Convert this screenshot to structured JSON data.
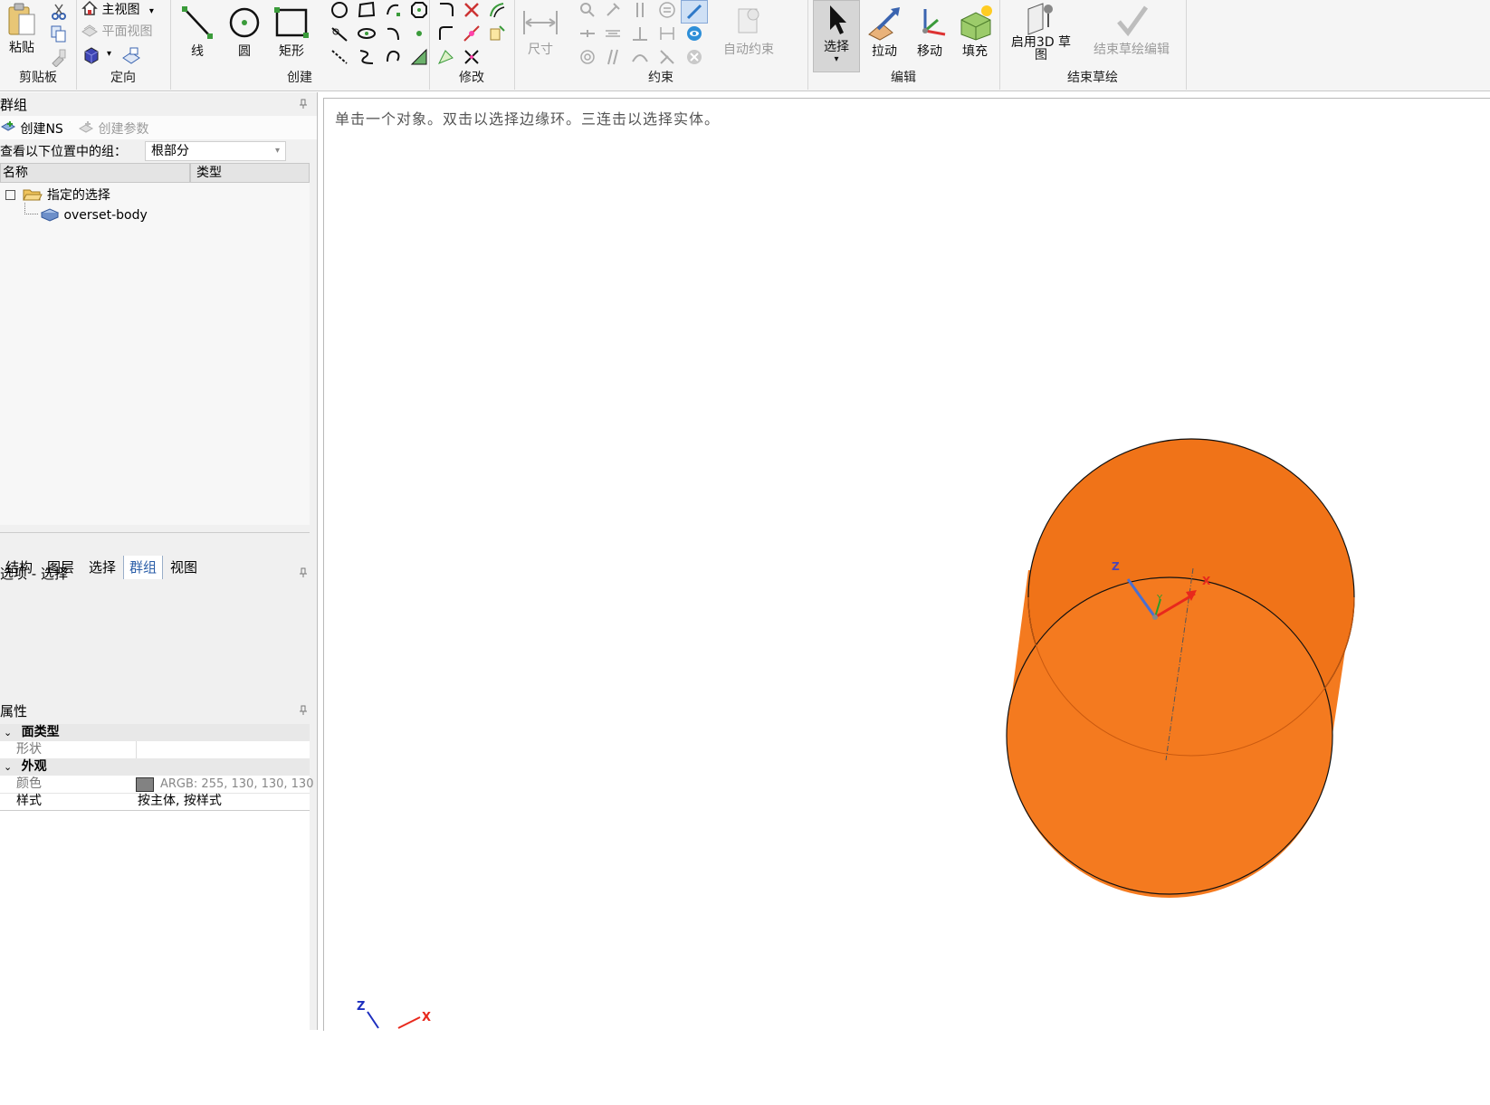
{
  "ribbon": {
    "clipboard": {
      "paste": "粘贴",
      "group": "剪贴板"
    },
    "orient": {
      "home_view": "主视图",
      "plan_view": "平面视图",
      "group": "定向"
    },
    "create": {
      "line": "线",
      "circle": "圆",
      "rect": "矩形",
      "group": "创建"
    },
    "modify": {
      "group": "修改"
    },
    "constraint": {
      "dimension": "尺寸",
      "auto": "自动约束",
      "group": "约束"
    },
    "edit": {
      "select": "选择",
      "pull": "拉动",
      "move": "移动",
      "fill": "填充",
      "group": "编辑"
    },
    "finish": {
      "enable3d": "启用3D 草图",
      "end_edit": "结束草绘编辑",
      "group": "结束草绘"
    }
  },
  "groups_panel": {
    "title": "群组",
    "create_ns": "创建NS",
    "create_param": "创建参数",
    "view_label": "查看以下位置中的组：",
    "view_value": "根部分",
    "col_name": "名称",
    "col_type": "类型",
    "tree": {
      "folder": "指定的选择",
      "child": "overset-body"
    }
  },
  "tabs": [
    "结构",
    "图层",
    "选择",
    "群组",
    "视图"
  ],
  "options_panel": {
    "title": "选项 - 选择"
  },
  "properties_panel": {
    "title": "属性",
    "face_type": "面类型",
    "shape": "形状",
    "appearance": "外观",
    "color_label": "颜色",
    "color_value": "ARGB: 255, 130, 130, 130",
    "style_label": "样式",
    "style_value": "按主体, 按样式"
  },
  "viewport": {
    "hint": "单击一个对象。双击以选择边缘环。三连击以选择实体。",
    "axis_z": "Z",
    "axis_x": "X",
    "axis_y": "Y",
    "body_color": "#f47a1f"
  }
}
